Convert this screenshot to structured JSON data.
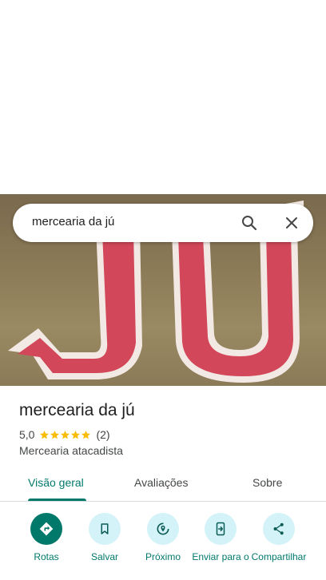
{
  "search": {
    "query": "mercearia da jú"
  },
  "place": {
    "title": "mercearia da jú",
    "rating": "5,0",
    "stars": 5,
    "review_count": "(2)",
    "category": "Mercearia atacadista"
  },
  "tabs": [
    {
      "label": "Visão geral"
    },
    {
      "label": "Avaliações"
    },
    {
      "label": "Sobre"
    }
  ],
  "actions": [
    {
      "label": "Rotas",
      "icon": "directions-icon"
    },
    {
      "label": "Salvar",
      "icon": "bookmark-icon"
    },
    {
      "label": "Próximo",
      "icon": "nearby-icon"
    },
    {
      "label": "Enviar para o",
      "icon": "send-to-phone-icon"
    },
    {
      "label": "Compartilhar",
      "icon": "share-icon"
    }
  ],
  "colors": {
    "accent": "#00796b",
    "accent_light": "#d3f3f8",
    "star": "#f9bb04",
    "photo_letters": "#d2475a"
  }
}
